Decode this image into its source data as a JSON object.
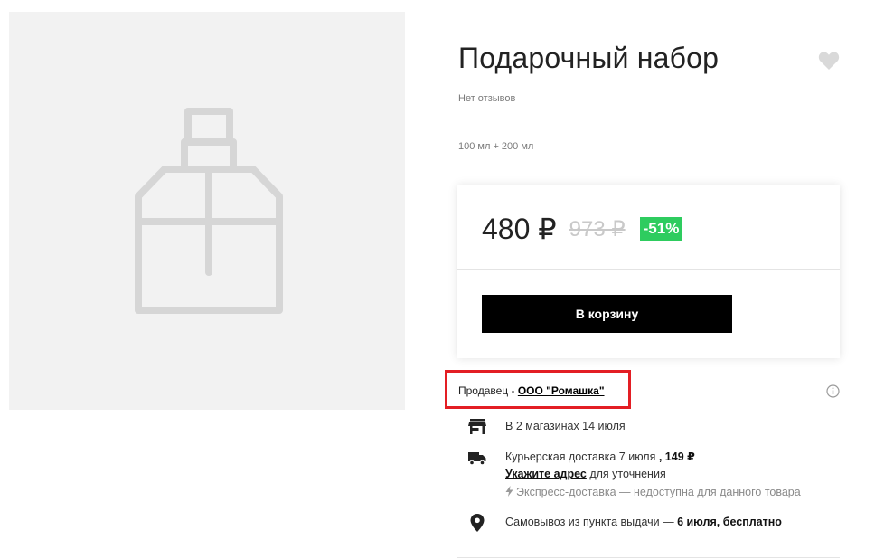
{
  "product": {
    "title": "Подарочный набор",
    "reviews": "Нет отзывов",
    "volume": "100 мл + 200 мл",
    "image_icon": "perfume-bottle-placeholder-icon",
    "favorite_icon": "heart-icon"
  },
  "price": {
    "current": "480 ₽",
    "old": "973 ₽",
    "discount": "-51%",
    "discount_color": "#2ecc5f",
    "add_to_cart_label": "В корзину"
  },
  "seller": {
    "label": "Продавец  - ",
    "name": "ООО \"Ромашка\"",
    "highlight_color": "#e31e24",
    "info_icon": "info-icon"
  },
  "delivery": {
    "stores": {
      "prefix": "В ",
      "link": "2 магазинах ",
      "date": "14 июля",
      "icon": "store-icon"
    },
    "courier": {
      "text": "Курьерская доставка 7 июля ",
      "price": ", 149 ₽",
      "address_link": "Укажите адрес",
      "address_suffix": " для уточнения",
      "express": "Экспресс-доставка — недоступна для данного товара",
      "icon": "truck-icon",
      "express_icon": "lightning-icon"
    },
    "pickup": {
      "text": "Самовывоз из пункта выдачи — ",
      "terms": "6 июля, бесплатно",
      "icon": "location-pin-icon"
    }
  }
}
